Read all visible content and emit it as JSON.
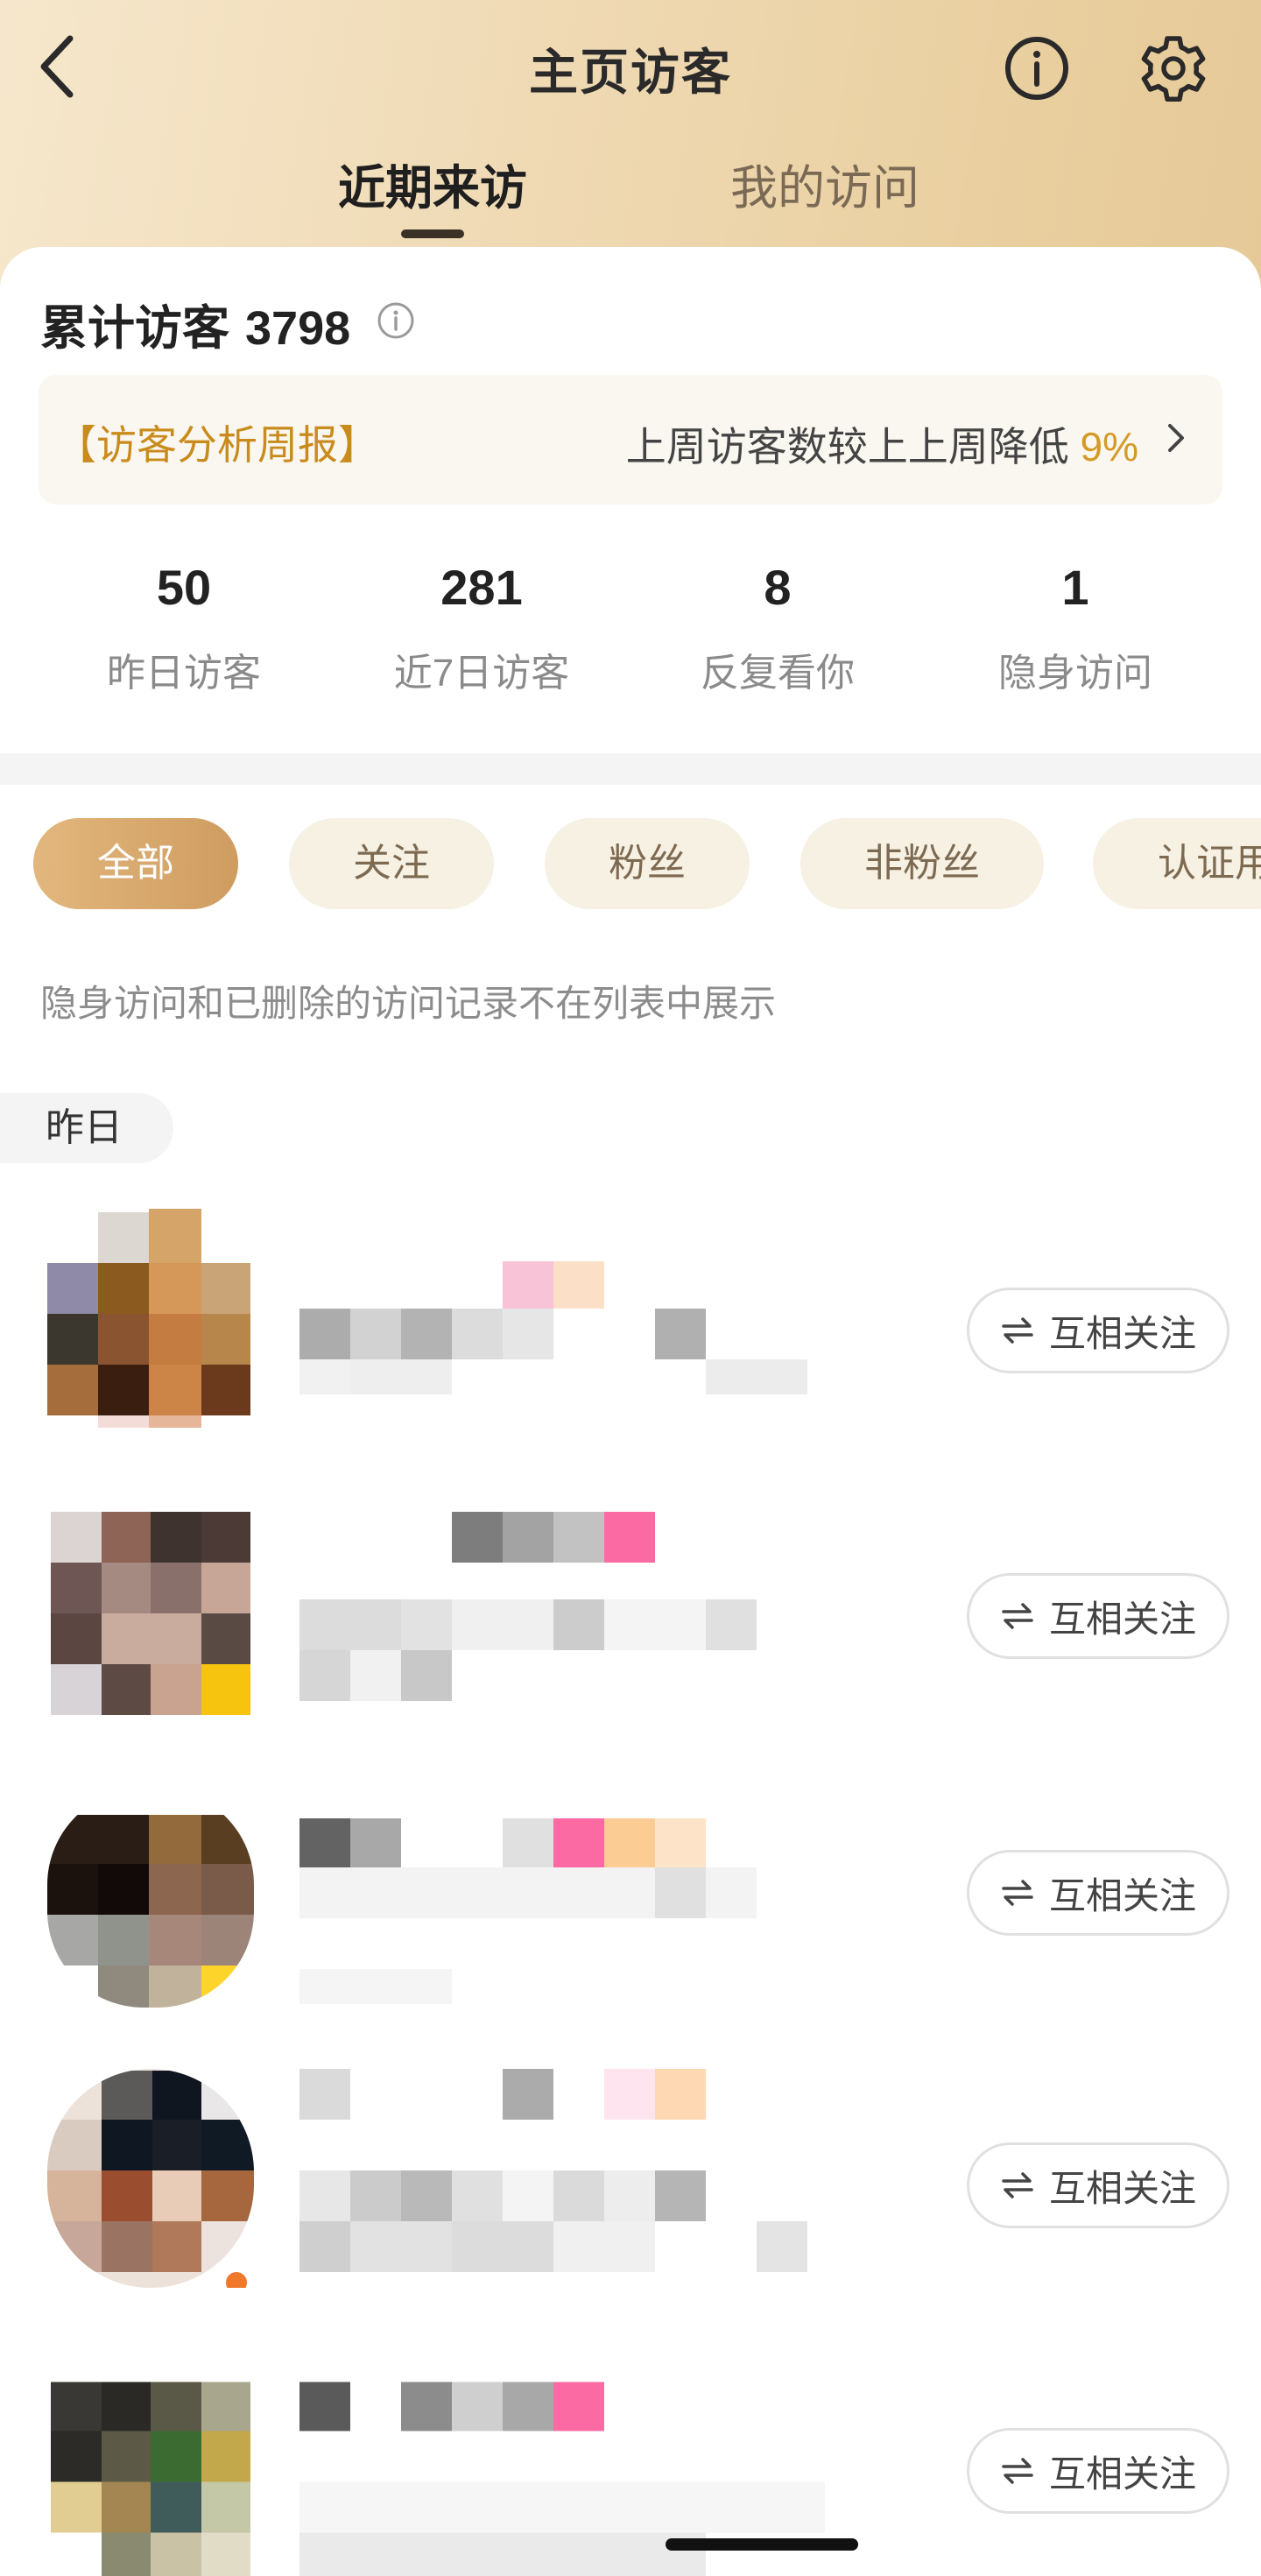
{
  "header": {
    "title": "主页访客",
    "tabs": [
      {
        "label": "近期来访",
        "active": true
      },
      {
        "label": "我的访问",
        "active": false
      }
    ],
    "icons": {
      "back": "chevron-left-icon",
      "info": "info-circle-icon",
      "settings": "gear-icon"
    }
  },
  "summary": {
    "total_label": "累计访客",
    "total_count": "3798",
    "report": {
      "title": "【访客分析周报】",
      "text": "上周访客数较上上周降低",
      "percent": "9%"
    },
    "stats": [
      {
        "value": "50",
        "label": "昨日访客"
      },
      {
        "value": "281",
        "label": "近7日访客"
      },
      {
        "value": "8",
        "label": "反复看你"
      },
      {
        "value": "1",
        "label": "隐身访问"
      }
    ]
  },
  "filters": [
    {
      "label": "全部",
      "active": true
    },
    {
      "label": "关注",
      "active": false
    },
    {
      "label": "粉丝",
      "active": false
    },
    {
      "label": "非粉丝",
      "active": false
    },
    {
      "label": "认证用",
      "active": false
    }
  ],
  "notice": "隐身访问和已删除的访问记录不在列表中展示",
  "section_date": "昨日",
  "visitors": [
    {
      "follow_label": "互相关注"
    },
    {
      "follow_label": "互相关注"
    },
    {
      "follow_label": "互相关注"
    },
    {
      "follow_label": "互相关注"
    },
    {
      "follow_label": "互相关注"
    }
  ],
  "colors": {
    "accent": "#c98b1c",
    "header_gradient_start": "#f6e7cc",
    "header_gradient_end": "#e6c998",
    "active_filter": "#d8a96d"
  }
}
